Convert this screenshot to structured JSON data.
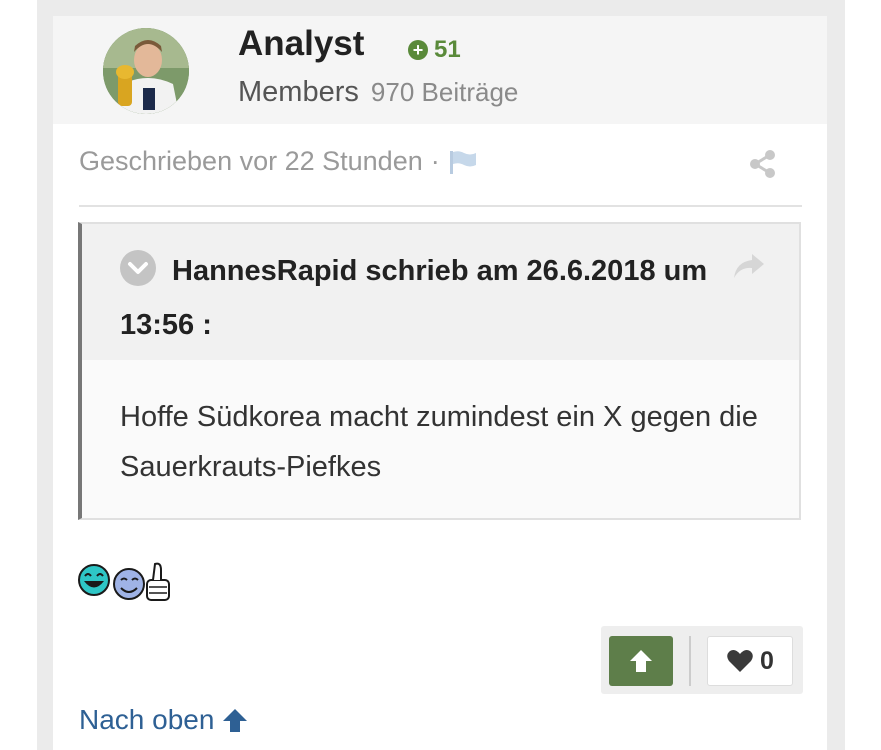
{
  "author": {
    "name": "Analyst",
    "reputation": "51",
    "group": "Members",
    "posts": "970 Beiträge"
  },
  "meta": {
    "posted": "Geschrieben vor 22 Stunden",
    "separator": "·"
  },
  "quote": {
    "citation": "HannesRapid schrieb am 26.6.2018 um 13:56 :",
    "body": "Hoffe Südkorea macht zumindest ein X gegen die Sauerkrauts-Piefkes"
  },
  "reactions": {
    "like_count": "0"
  },
  "footer": {
    "back_to_top": "Nach oben"
  },
  "colors": {
    "accent_green": "#5e7e4a",
    "link_blue": "#2e6094"
  }
}
